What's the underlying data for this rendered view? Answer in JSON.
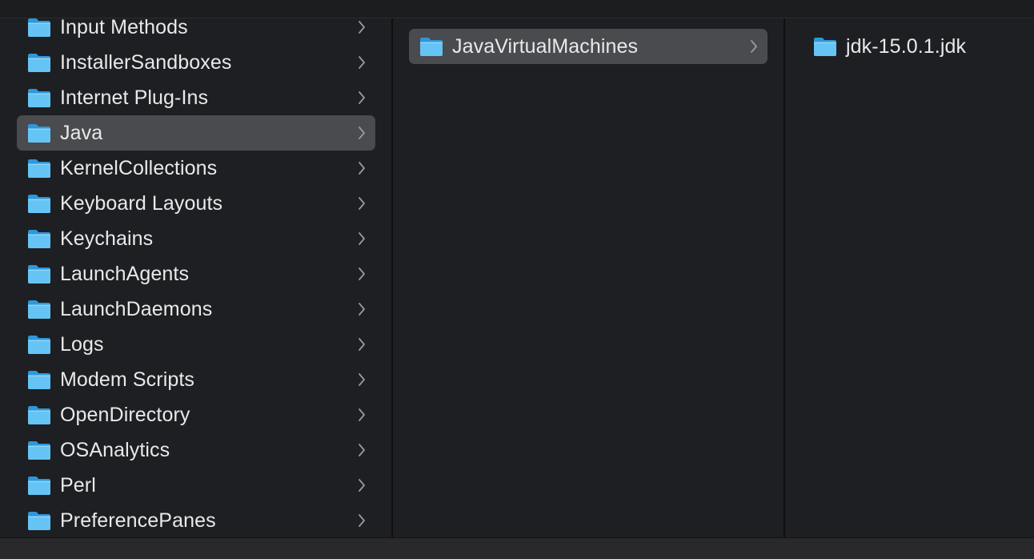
{
  "colors": {
    "background": "#1e1f22",
    "selection": "#4a4b4e",
    "folder_light": "#66c4f5",
    "folder_dark": "#2f97db",
    "text": "#e9e9ea",
    "chevron": "#9a9a9c"
  },
  "columns": [
    {
      "items": [
        {
          "label": "Input Methods",
          "icon": "folder-icon",
          "has_children": true,
          "selected": false
        },
        {
          "label": "InstallerSandboxes",
          "icon": "folder-icon",
          "has_children": true,
          "selected": false
        },
        {
          "label": "Internet Plug-Ins",
          "icon": "folder-icon",
          "has_children": true,
          "selected": false
        },
        {
          "label": "Java",
          "icon": "folder-icon",
          "has_children": true,
          "selected": true
        },
        {
          "label": "KernelCollections",
          "icon": "folder-icon",
          "has_children": true,
          "selected": false
        },
        {
          "label": "Keyboard Layouts",
          "icon": "folder-icon",
          "has_children": true,
          "selected": false
        },
        {
          "label": "Keychains",
          "icon": "folder-icon",
          "has_children": true,
          "selected": false
        },
        {
          "label": "LaunchAgents",
          "icon": "folder-icon",
          "has_children": true,
          "selected": false
        },
        {
          "label": "LaunchDaemons",
          "icon": "folder-icon",
          "has_children": true,
          "selected": false
        },
        {
          "label": "Logs",
          "icon": "folder-icon",
          "has_children": true,
          "selected": false
        },
        {
          "label": "Modem Scripts",
          "icon": "folder-icon",
          "has_children": true,
          "selected": false
        },
        {
          "label": "OpenDirectory",
          "icon": "folder-icon",
          "has_children": true,
          "selected": false
        },
        {
          "label": "OSAnalytics",
          "icon": "folder-icon",
          "has_children": true,
          "selected": false
        },
        {
          "label": "Perl",
          "icon": "folder-icon",
          "has_children": true,
          "selected": false
        },
        {
          "label": "PreferencePanes",
          "icon": "folder-icon",
          "has_children": true,
          "selected": false
        }
      ]
    },
    {
      "items": [
        {
          "label": "JavaVirtualMachines",
          "icon": "folder-icon",
          "has_children": true,
          "selected": true
        }
      ]
    },
    {
      "items": [
        {
          "label": "jdk-15.0.1.jdk",
          "icon": "folder-icon",
          "has_children": false,
          "selected": false
        }
      ]
    }
  ]
}
